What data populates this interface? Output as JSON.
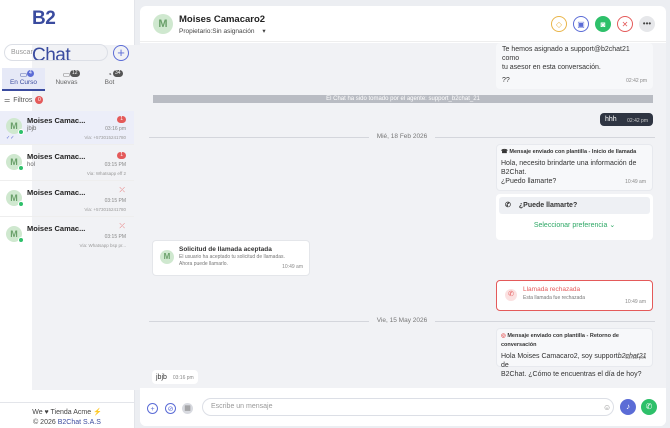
{
  "app": {
    "logo_b2": "B2",
    "logo_chat": "Chat"
  },
  "sidebar": {
    "search_placeholder": "Buscar",
    "add": "+",
    "tabs": [
      {
        "label": "En Curso",
        "count": "4"
      },
      {
        "label": "Nuevas",
        "count": "12"
      },
      {
        "label": "Bot",
        "count": "34"
      }
    ],
    "filters_label": "Filtros",
    "filters_count": "0",
    "conversations": [
      {
        "name": "Moises Camac...",
        "message": "jbjb",
        "time": "03:16 pm",
        "via": "Via: +573015241780",
        "badge": "1",
        "check": "✓✓"
      },
      {
        "name": "Moises Camac...",
        "message": "hol",
        "time": "03:15 PM",
        "via": "Via: Whatsapp eff 2",
        "badge": "1"
      },
      {
        "name": "Moises Camac...",
        "message": "",
        "time": "03:15 PM",
        "via": "Via: +573015241780",
        "badge": ""
      },
      {
        "name": "Moises Camac...",
        "message": "",
        "time": "03:15 PM",
        "via": "Via: Whatsapp bsp pr...",
        "badge": ""
      }
    ],
    "footer_line1": "We ♥ Tienda Acme ⚡",
    "footer_copy": "© 2026",
    "footer_link": "B2Chat S.A.S"
  },
  "header": {
    "avatar": "M",
    "name": "Moises Camacaro2",
    "owner_label": "Propietario:",
    "owner_value": "Sin asignación"
  },
  "chat": {
    "msg1": {
      "text1": "Te hemos asignado a support@b2chat21 como",
      "text2": "tu asesor en esta conversación.",
      "text3": "??",
      "time": "02:42 pm"
    },
    "system": "El Chat ha sido tomado por el agente: support_b2chat_21",
    "hhh": {
      "text": "hhh",
      "time": "02:42 pm"
    },
    "date1": "Mié, 18 Feb 2026",
    "tpl1": {
      "title": "Mensaje enviado con plantilla - Inicio de llamada",
      "l1": "Hola, necesito brindarte una información de",
      "l2": "B2Chat.",
      "l3": "¿Puedo llamarte?",
      "time": "10:49 am",
      "question": "¿Puede llamarte?",
      "select": "Seleccionar preferencia"
    },
    "accepted": {
      "title": "Solicitud de llamada aceptada",
      "l1": "El usuario ha aceptado tu solicitud de llamadas.",
      "l2": "Ahora puede llamarlo.",
      "time": "10:49 am"
    },
    "rejected": {
      "title": "Llamada rechazada",
      "sub": "Esta llamada fue rechazada",
      "time": "10:49 am"
    },
    "date2": "Vie, 15 May 2026",
    "tpl2": {
      "title": "Mensaje enviado con plantilla - Retorno de conversación",
      "l1": "Hola  Moises Camacaro2, soy  support",
      "l1b": "b2chat21",
      "l1c": " de",
      "l2": "B2Chat. ¿Cómo te encuentras el día de hoy?",
      "time": "03:15 pm"
    },
    "jbjb": {
      "text": "jbjb",
      "time": "03:16 pm"
    }
  },
  "input": {
    "placeholder": "Escribe un mensaje"
  }
}
